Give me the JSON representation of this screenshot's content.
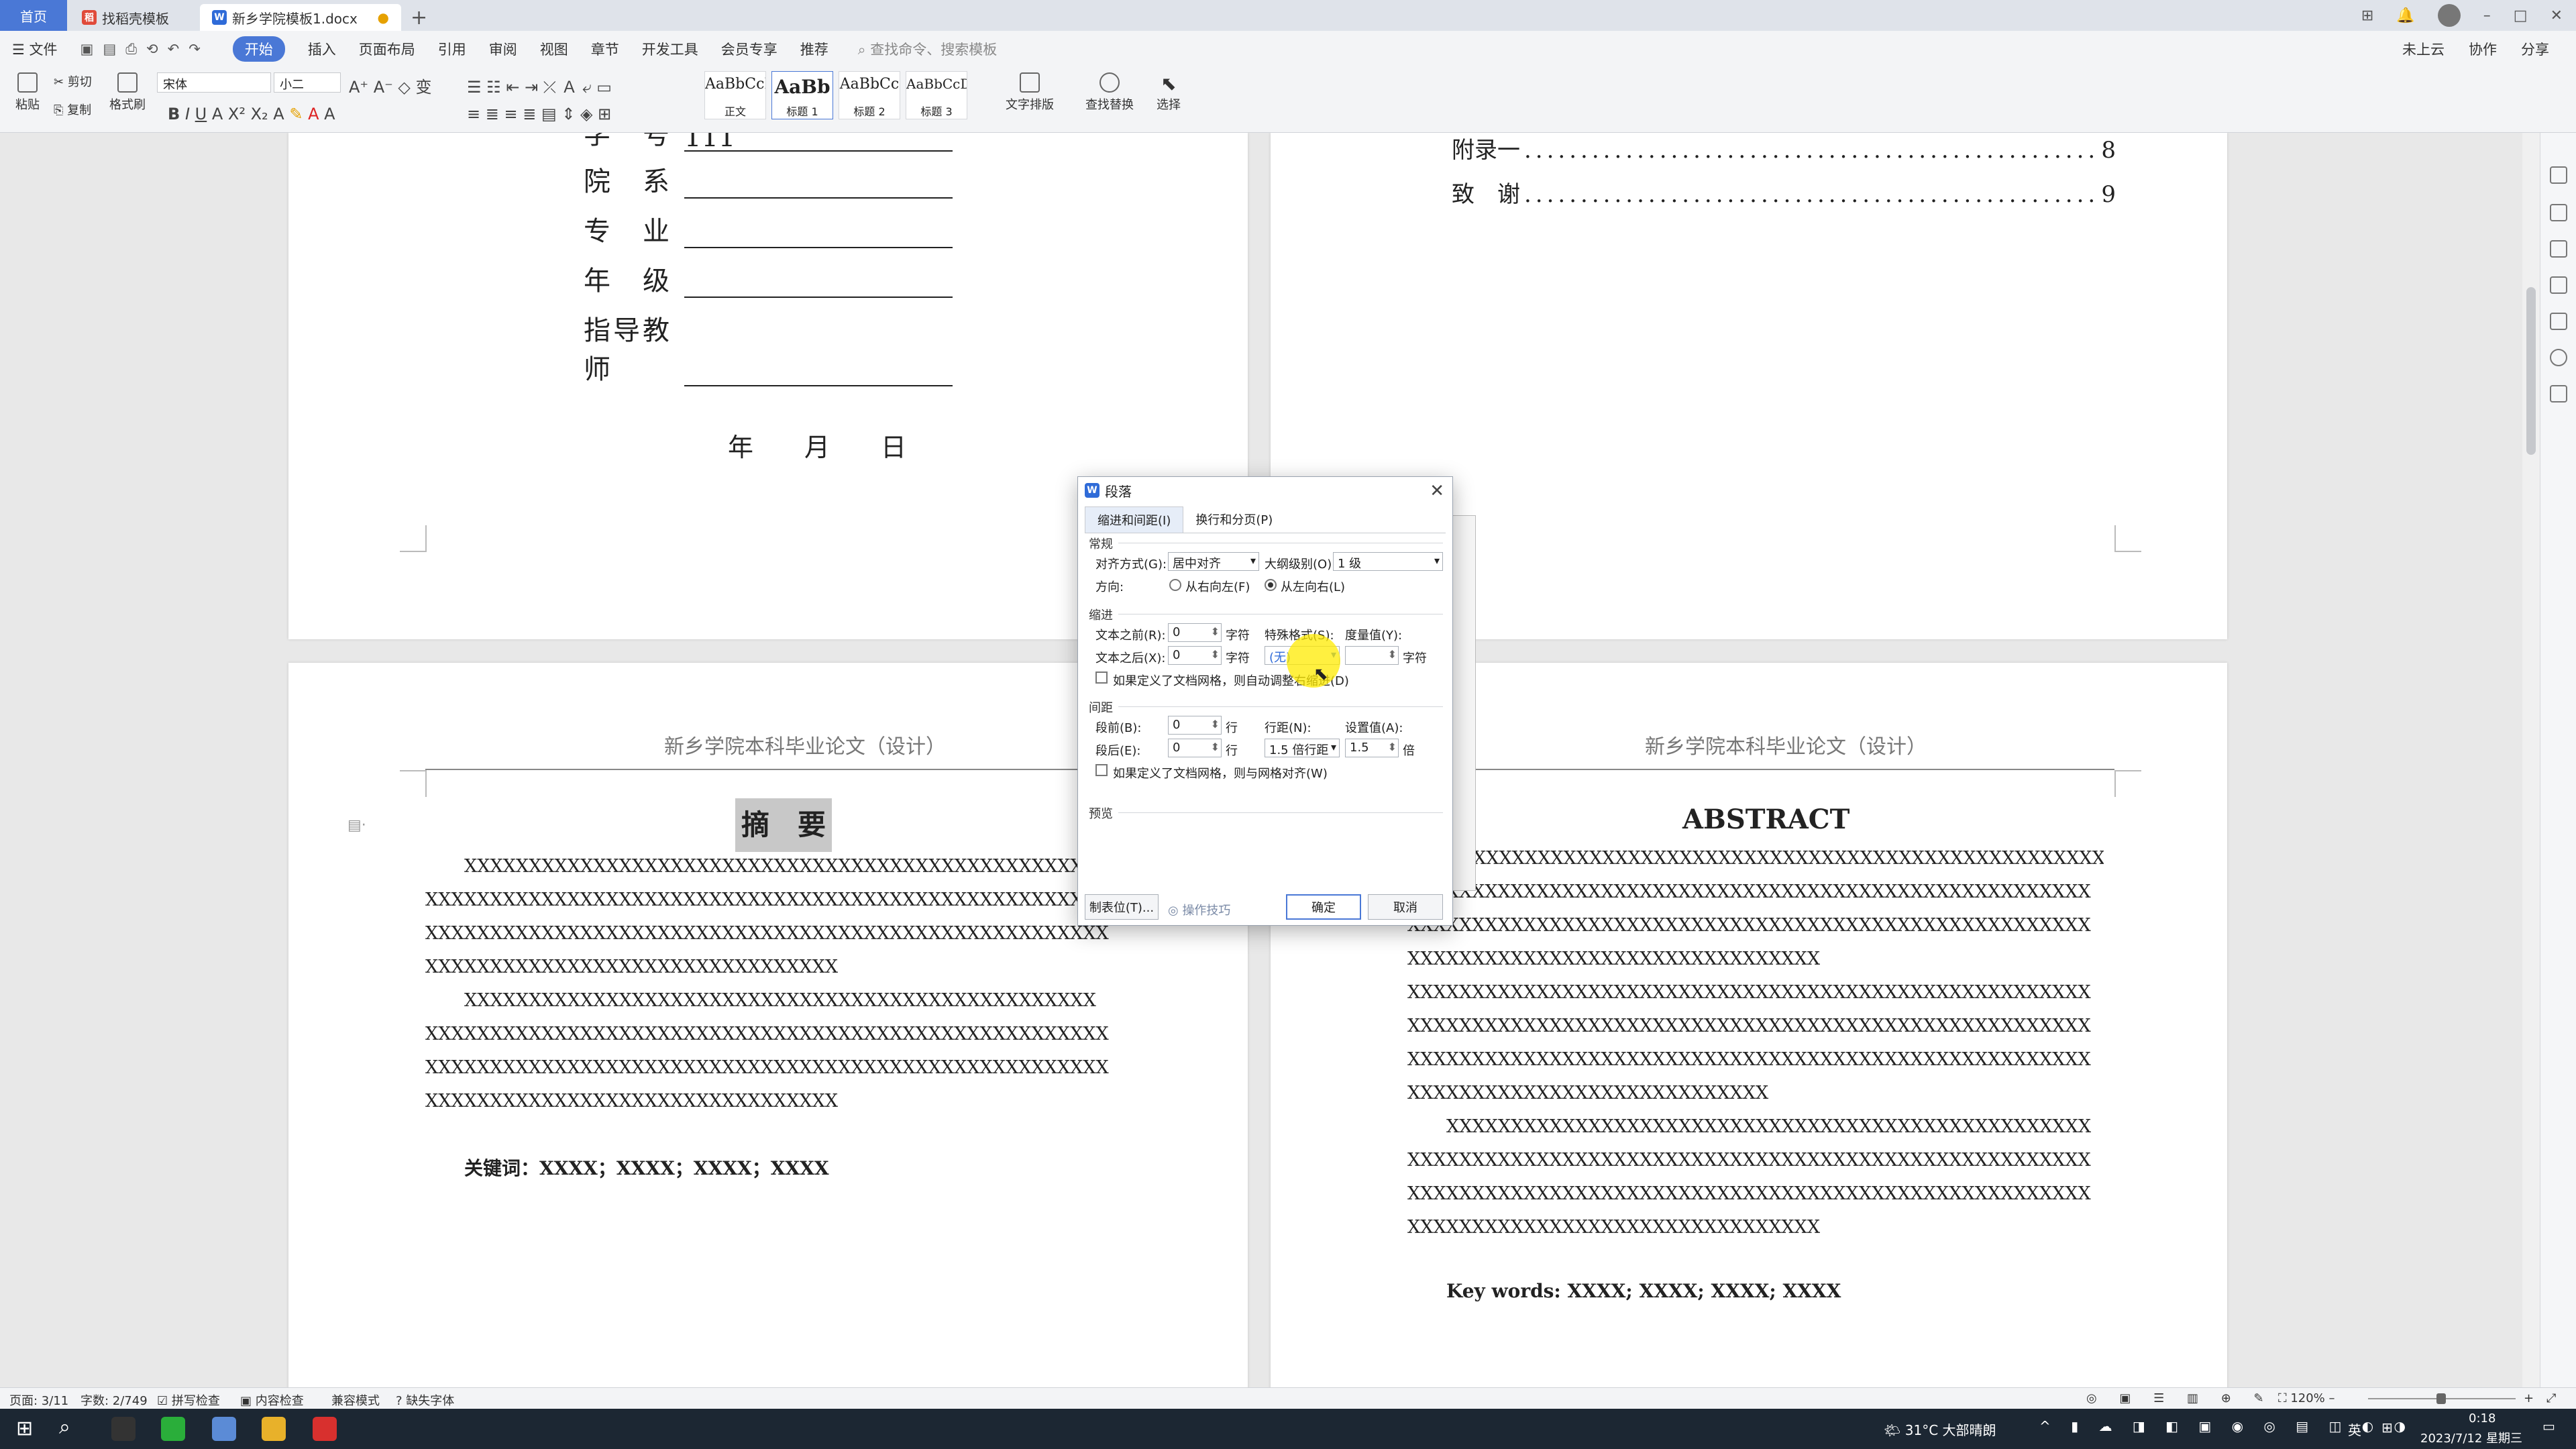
{
  "tabs": {
    "home": "首页",
    "templates": "找稻壳模板",
    "document": "新乡学院模板1.docx",
    "plus": "+"
  },
  "menu": {
    "file": "文件",
    "items": [
      "开始",
      "插入",
      "页面布局",
      "引用",
      "审阅",
      "视图",
      "章节",
      "开发工具",
      "会员专享",
      "推荐"
    ],
    "search": "查找命令、搜索模板",
    "right": [
      "未上云",
      "协作",
      "分享"
    ]
  },
  "toolbar": {
    "paste": "粘贴",
    "cut": "剪切",
    "copy": "复制",
    "format_painter": "格式刷",
    "font_name": "宋体",
    "font_size": "小二",
    "styles": [
      {
        "sample": "AaBbCcI",
        "label": "正文"
      },
      {
        "sample": "AaBb",
        "label": "标题 1"
      },
      {
        "sample": "AaBbCc",
        "label": "标题 2"
      },
      {
        "sample": "AaBbCcDc",
        "label": "标题 3"
      }
    ],
    "text_layout": "文字排版",
    "find_replace": "查找替换",
    "select": "选择"
  },
  "cover": {
    "rows": [
      {
        "label": "学　号",
        "value": "111"
      },
      {
        "label": "院　系",
        "value": ""
      },
      {
        "label": "专　业",
        "value": ""
      },
      {
        "label": "年　级",
        "value": ""
      },
      {
        "label": "指导教师",
        "value": ""
      }
    ],
    "date_line": "年　　月　　日"
  },
  "toc": [
    {
      "title": "附录一",
      "page": "8"
    },
    {
      "title": "致　谢",
      "page": "9"
    }
  ],
  "header_text": "新乡学院本科毕业论文（设计）",
  "abstract_cn": {
    "title": "摘　要",
    "lines": [
      "XXXXXXXXXXXXXXXXXXXXXXXXXXXXXXXXXXXXXXXXXXXXXXXXX",
      "XXXXXXXXXXXXXXXXXXXXXXXXXXXXXXXXXXXXXXXXXXXXXXXXXXXXX",
      "XXXXXXXXXXXXXXXXXXXXXXXXXXXXXXXXXXXXXXXXXXXXXXXXXXXXX",
      "XXXXXXXXXXXXXXXXXXXXXXXXXXXXXXXX",
      "XXXXXXXXXXXXXXXXXXXXXXXXXXXXXXXXXXXXXXXXXXXXXXXXX",
      "XXXXXXXXXXXXXXXXXXXXXXXXXXXXXXXXXXXXXXXXXXXXXXXXXXXXX",
      "XXXXXXXXXXXXXXXXXXXXXXXXXXXXXXXXXXXXXXXXXXXXXXXXXXXXX",
      "XXXXXXXXXXXXXXXXXXXXXXXXXXXXXXXX"
    ],
    "keywords": "关键词：XXXX；XXXX；XXXX；XXXX"
  },
  "abstract_en": {
    "title": "ABSTRACT",
    "lines": [
      "XXXXXXXXXXXXXXXXXXXXXXXXXXXXXXXXXXXXXXXXXXXXXXXXXX",
      "XXXXXXXXXXXXXXXXXXXXXXXXXXXXXXXXXXXXXXXXXXXXXXXXXXXXX",
      "XXXXXXXXXXXXXXXXXXXXXXXXXXXXXXXXXXXXXXXXXXXXXXXXXXXXX",
      "XXXXXXXXXXXXXXXXXXXXXXXXXXXXXXXX",
      "XXXXXXXXXXXXXXXXXXXXXXXXXXXXXXXXXXXXXXXXXXXXXXXXXXXXX",
      "XXXXXXXXXXXXXXXXXXXXXXXXXXXXXXXXXXXXXXXXXXXXXXXXXXXXX",
      "XXXXXXXXXXXXXXXXXXXXXXXXXXXXXXXXXXXXXXXXXXXXXXXXXXXXX",
      "XXXXXXXXXXXXXXXXXXXXXXXXXXXX",
      "XXXXXXXXXXXXXXXXXXXXXXXXXXXXXXXXXXXXXXXXXXXXXXXXXX",
      "XXXXXXXXXXXXXXXXXXXXXXXXXXXXXXXXXXXXXXXXXXXXXXXXXXXXX",
      "XXXXXXXXXXXXXXXXXXXXXXXXXXXXXXXXXXXXXXXXXXXXXXXXXXXXX",
      "XXXXXXXXXXXXXXXXXXXXXXXXXXXXXXXX"
    ],
    "keywords": "Key words: XXXX; XXXX; XXXX; XXXX"
  },
  "dialog": {
    "title": "段落",
    "tabs": [
      "缩进和间距(I)",
      "换行和分页(P)"
    ],
    "sec_general": "常规",
    "align_label": "对齐方式(G):",
    "align_value": "居中对齐",
    "outline_label": "大纲级别(O):",
    "outline_value": "1 级",
    "direction_label": "方向:",
    "rtl": "从右向左(F)",
    "ltr": "从左向右(L)",
    "sec_indent": "缩进",
    "before_text_label": "文本之前(R):",
    "before_text_value": "0",
    "after_text_label": "文本之后(X):",
    "after_text_value": "0",
    "unit_char": "字符",
    "special_label": "特殊格式(S):",
    "special_value": "(无)",
    "measure_label": "度量值(Y):",
    "measure_value": "",
    "grid_indent": "如果定义了文档网格，则自动调整右缩进(D)",
    "sec_spacing": "间距",
    "before_label": "段前(B):",
    "before_value": "0",
    "after_label": "段后(E):",
    "after_value": "0",
    "unit_line": "行",
    "line_spacing_label": "行距(N):",
    "line_spacing_value": "1.5 倍行距",
    "setting_label": "设置值(A):",
    "setting_value": "1.5",
    "unit_times": "倍",
    "grid_spacing": "如果定义了文档网格，则与网格对齐(W)",
    "sec_preview": "预览",
    "tabs_btn": "制表位(T)...",
    "tips": "操作技巧",
    "ok": "确定",
    "cancel": "取消"
  },
  "status": {
    "page": "页面: 3/11",
    "words": "字数: 2/749",
    "spell": "拼写检查",
    "content": "内容检查",
    "compat": "兼容模式",
    "missing_font": "缺失字体",
    "zoom": "120%"
  },
  "taskbar": {
    "weather": "31°C 大部晴朗",
    "ime": "英",
    "time": "0:18",
    "date": "2023/7/12 星期三"
  },
  "colors": {
    "accent": "#4a78d6",
    "highlight": "#ffeb00"
  }
}
